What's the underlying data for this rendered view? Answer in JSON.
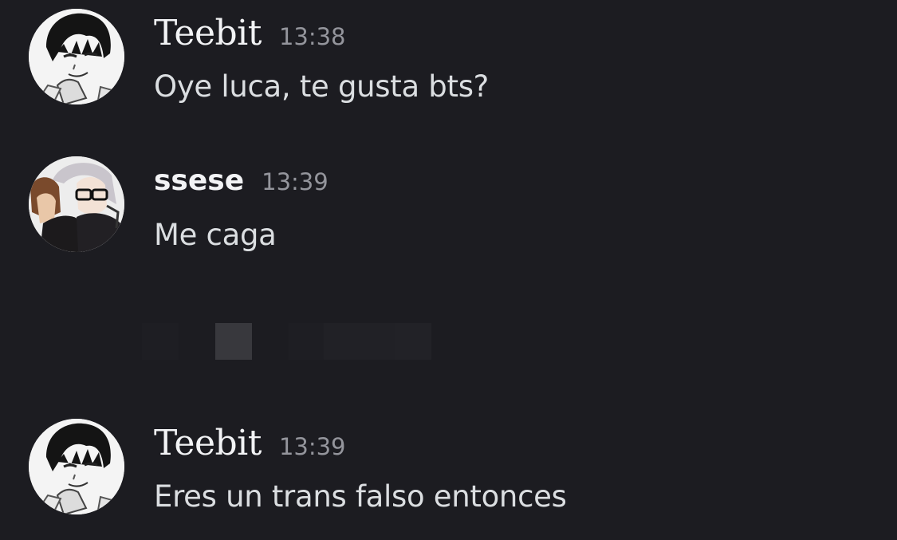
{
  "messages": [
    {
      "username": "Teebit",
      "timestamp": "13:38",
      "text": "Oye luca, te gusta bts?",
      "avatar_icon": "manga-portrait-avatar"
    },
    {
      "username": "ssese",
      "timestamp": "13:39",
      "text": "Me caga",
      "avatar_icon": "anime-duo-avatar"
    },
    {
      "username": "Teebit",
      "timestamp": "13:39",
      "text": "Eres un trans falso entonces",
      "avatar_icon": "manga-portrait-avatar"
    }
  ],
  "colors": {
    "background": "#1c1c21",
    "username": "#f2f3f5",
    "timestamp": "#94959c",
    "message_text": "#dbdee1"
  }
}
